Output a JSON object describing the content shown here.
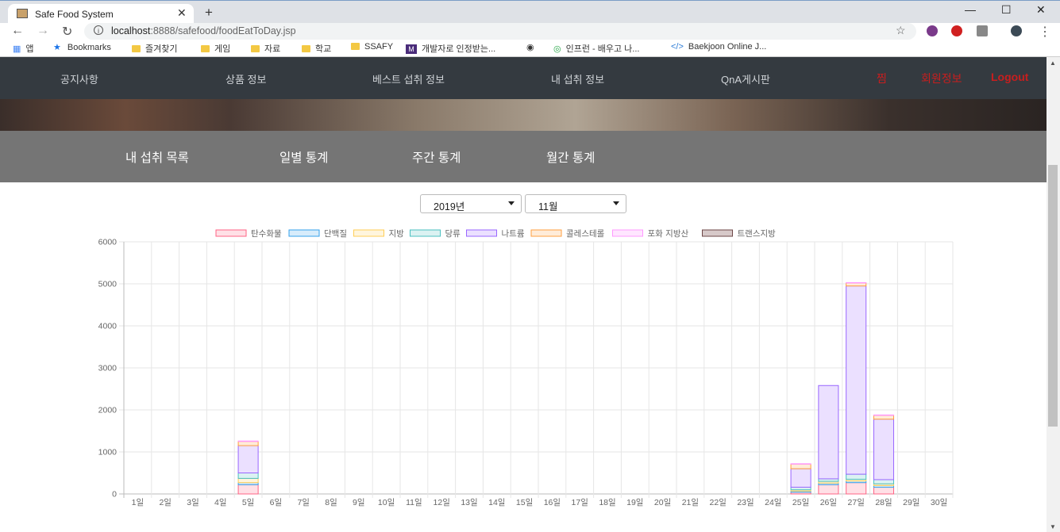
{
  "browser": {
    "tab_title": "Safe Food System",
    "url_host": "localhost",
    "url_rest": ":8888/safefood/foodEatToDay.jsp",
    "bookmarks": [
      "앱",
      "Bookmarks",
      "즐겨찾기",
      "게임",
      "자료",
      "학교",
      "SSAFY",
      "개발자로 인정받는...",
      "인프런 - 배우고 나...",
      "Baekjoon Online J..."
    ]
  },
  "navbar": {
    "items": [
      "공지사항",
      "상품 정보",
      "베스트 섭취 정보",
      "내 섭취 정보",
      "QnA게시판"
    ],
    "right_items": [
      "찜",
      "회원정보",
      "Logout"
    ]
  },
  "subnav": {
    "items": [
      "내 섭취 목록",
      "일별 통계",
      "주간 통계",
      "월간 통계"
    ]
  },
  "filters": {
    "year": "2019년",
    "month": "11월"
  },
  "colors": {
    "nav_bg": "#343a40",
    "subnav_bg": "#757575",
    "nav_red": "#c81e1e"
  },
  "chart_data": {
    "type": "bar",
    "stacked": true,
    "ylim": [
      0,
      6000
    ],
    "yticks": [
      "0",
      "1000",
      "2000",
      "3000",
      "4000",
      "5000",
      "6000"
    ],
    "grid": true,
    "legend": "top",
    "categories": [
      "1일",
      "2일",
      "3일",
      "4일",
      "5일",
      "6일",
      "7일",
      "8일",
      "9일",
      "10일",
      "11일",
      "12일",
      "13일",
      "14일",
      "15일",
      "16일",
      "17일",
      "18일",
      "19일",
      "20일",
      "21일",
      "22일",
      "23일",
      "24일",
      "25일",
      "26일",
      "27일",
      "28일",
      "29일",
      "30일"
    ],
    "series": [
      {
        "name": "탄수화물",
        "fill": "#ffe0e6",
        "stroke": "#ff6384",
        "values": [
          0,
          0,
          0,
          0,
          220,
          0,
          0,
          0,
          0,
          0,
          0,
          0,
          0,
          0,
          0,
          0,
          0,
          0,
          0,
          0,
          0,
          0,
          0,
          0,
          40,
          220,
          270,
          160,
          0,
          0
        ]
      },
      {
        "name": "단백질",
        "fill": "#d7ecfb",
        "stroke": "#36a2eb",
        "values": [
          0,
          0,
          0,
          0,
          50,
          0,
          0,
          0,
          0,
          0,
          0,
          0,
          0,
          0,
          0,
          0,
          0,
          0,
          0,
          0,
          0,
          0,
          0,
          0,
          30,
          40,
          40,
          40,
          0,
          0
        ]
      },
      {
        "name": "지방",
        "fill": "#fff5dd",
        "stroke": "#ffce56",
        "values": [
          0,
          0,
          0,
          0,
          100,
          0,
          0,
          0,
          0,
          0,
          0,
          0,
          0,
          0,
          0,
          0,
          0,
          0,
          0,
          0,
          0,
          0,
          0,
          0,
          30,
          40,
          40,
          40,
          0,
          0
        ]
      },
      {
        "name": "당류",
        "fill": "#dbf2f2",
        "stroke": "#4bc0c0",
        "values": [
          0,
          0,
          0,
          0,
          130,
          0,
          0,
          0,
          0,
          0,
          0,
          0,
          0,
          0,
          0,
          0,
          0,
          0,
          0,
          0,
          0,
          0,
          0,
          0,
          60,
          60,
          120,
          100,
          0,
          0
        ]
      },
      {
        "name": "나트륨",
        "fill": "#ebe0ff",
        "stroke": "#9966ff",
        "values": [
          0,
          0,
          0,
          0,
          650,
          0,
          0,
          0,
          0,
          0,
          0,
          0,
          0,
          0,
          0,
          0,
          0,
          0,
          0,
          0,
          0,
          0,
          0,
          0,
          440,
          2220,
          4480,
          1440,
          0,
          0
        ]
      },
      {
        "name": "콜레스테롤",
        "fill": "#ffecd9",
        "stroke": "#ff9f40",
        "values": [
          0,
          0,
          0,
          0,
          100,
          0,
          0,
          0,
          0,
          0,
          0,
          0,
          0,
          0,
          0,
          0,
          0,
          0,
          0,
          0,
          0,
          0,
          0,
          0,
          110,
          0,
          70,
          90,
          0,
          0
        ]
      },
      {
        "name": "포화 지방산",
        "fill": "#ffe6ff",
        "stroke": "#ff99ff",
        "values": [
          0,
          0,
          0,
          0,
          10,
          0,
          0,
          0,
          0,
          0,
          0,
          0,
          0,
          0,
          0,
          0,
          0,
          0,
          0,
          0,
          0,
          0,
          0,
          0,
          10,
          0,
          10,
          10,
          0,
          0
        ]
      },
      {
        "name": "트랜스지방",
        "fill": "#d7c9c9",
        "stroke": "#6e4747",
        "values": [
          0,
          0,
          0,
          0,
          0,
          0,
          0,
          0,
          0,
          0,
          0,
          0,
          0,
          0,
          0,
          0,
          0,
          0,
          0,
          0,
          0,
          0,
          0,
          0,
          0,
          0,
          0,
          0,
          0,
          0
        ]
      }
    ]
  }
}
